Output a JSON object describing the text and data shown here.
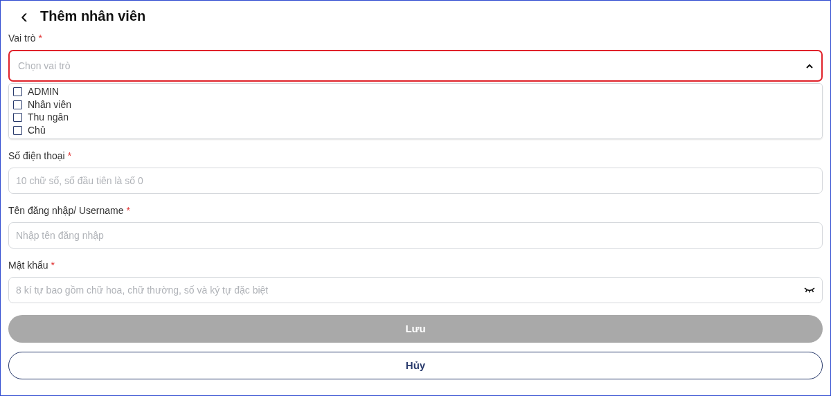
{
  "header": {
    "back_icon": "‹",
    "title": "Thêm nhân viên"
  },
  "role_field": {
    "label": "Vai trò",
    "required_mark": "*",
    "placeholder": "Chọn vai trò",
    "expanded": true,
    "invalid": true,
    "options": [
      {
        "label": "ADMIN",
        "checked": false
      },
      {
        "label": "Nhân viên",
        "checked": false
      },
      {
        "label": "Thu ngân",
        "checked": false
      },
      {
        "label": "Chủ",
        "checked": false
      }
    ]
  },
  "fields": [
    {
      "kind": "text",
      "label": "Số điện thoại",
      "required_mark": "*",
      "placeholder": "10 chữ số, số đầu tiên là số 0"
    },
    {
      "kind": "text",
      "label": "Tên đăng nhập/ Username",
      "required_mark": "*",
      "placeholder": "Nhập tên đăng nhập"
    },
    {
      "kind": "password",
      "label": "Mật khẩu",
      "required_mark": "*",
      "placeholder": "8 kí tự bao gồm chữ hoa, chữ thường, số và ký tự đặc biệt"
    }
  ],
  "buttons": [
    {
      "kind": "primary",
      "label": "Lưu",
      "disabled": true
    },
    {
      "kind": "outline",
      "label": "Hủy",
      "disabled": false
    }
  ]
}
